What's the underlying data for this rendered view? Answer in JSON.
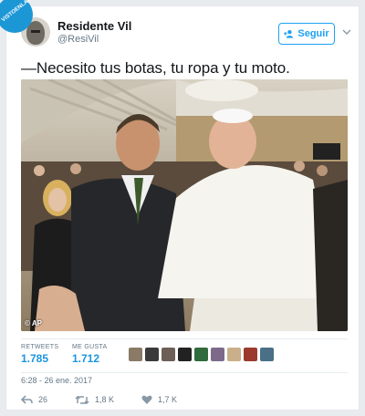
{
  "watermark": {
    "text": "VISTOENLASREDES.COM"
  },
  "author": {
    "name": "Residente Vil",
    "handle": "@ResiVil"
  },
  "follow_button": {
    "label": "Seguir",
    "icon": "add-user-icon"
  },
  "tweet": {
    "text": "—Necesito tus botas, tu ropa y tu moto."
  },
  "photo": {
    "credit": "© AP"
  },
  "stats": {
    "retweets_label": "RETWEETS",
    "retweets_value": "1.785",
    "likes_label": "ME GUSTA",
    "likes_value": "1.712",
    "liker_colors": [
      "#8a7a66",
      "#3a3a3a",
      "#6d5f56",
      "#222222",
      "#2f6b3c",
      "#7d6a8a",
      "#c9b08a",
      "#9b3b2e",
      "#4a6f87"
    ]
  },
  "timestamp": "6:28 - 26 ene. 2017",
  "actions": {
    "reply_count": "26",
    "retweet_count": "1,8 K",
    "like_count": "1,7 K"
  },
  "colors": {
    "accent": "#1da1f2",
    "stat_value": "#1b95e0"
  }
}
